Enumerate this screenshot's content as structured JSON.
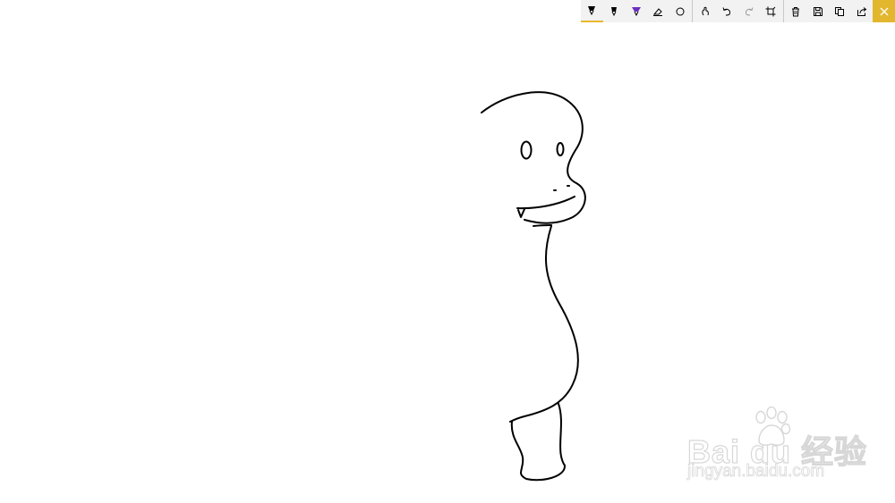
{
  "toolbar": {
    "tools": [
      {
        "id": "ballpoint-pen",
        "icon": "ballpoint-pen-icon",
        "active": true
      },
      {
        "id": "pencil",
        "icon": "pencil-icon",
        "active": false
      },
      {
        "id": "highlighter",
        "icon": "highlighter-icon",
        "active": false
      },
      {
        "id": "eraser",
        "icon": "eraser-icon",
        "active": false
      },
      {
        "id": "ruler",
        "icon": "ruler-icon",
        "active": false
      },
      {
        "id": "touch-writing",
        "icon": "touch-writing-icon",
        "active": false
      },
      {
        "id": "undo",
        "icon": "undo-icon",
        "active": false
      },
      {
        "id": "redo",
        "icon": "redo-icon",
        "active": false,
        "disabled": true
      },
      {
        "id": "crop",
        "icon": "crop-icon",
        "active": false
      },
      {
        "id": "clear",
        "icon": "trash-icon",
        "active": false
      },
      {
        "id": "save",
        "icon": "save-icon",
        "active": false
      },
      {
        "id": "copy",
        "icon": "copy-icon",
        "active": false
      },
      {
        "id": "share",
        "icon": "share-icon",
        "active": false
      }
    ],
    "close_icon": "close-icon",
    "accent_color": "#e2b72e",
    "pen_colors": {
      "ballpoint": "#000000",
      "highlighter": "#6b2fbf"
    }
  },
  "watermark": {
    "brand": "Bai du 经验",
    "url": "jingyan.baidu.com"
  }
}
